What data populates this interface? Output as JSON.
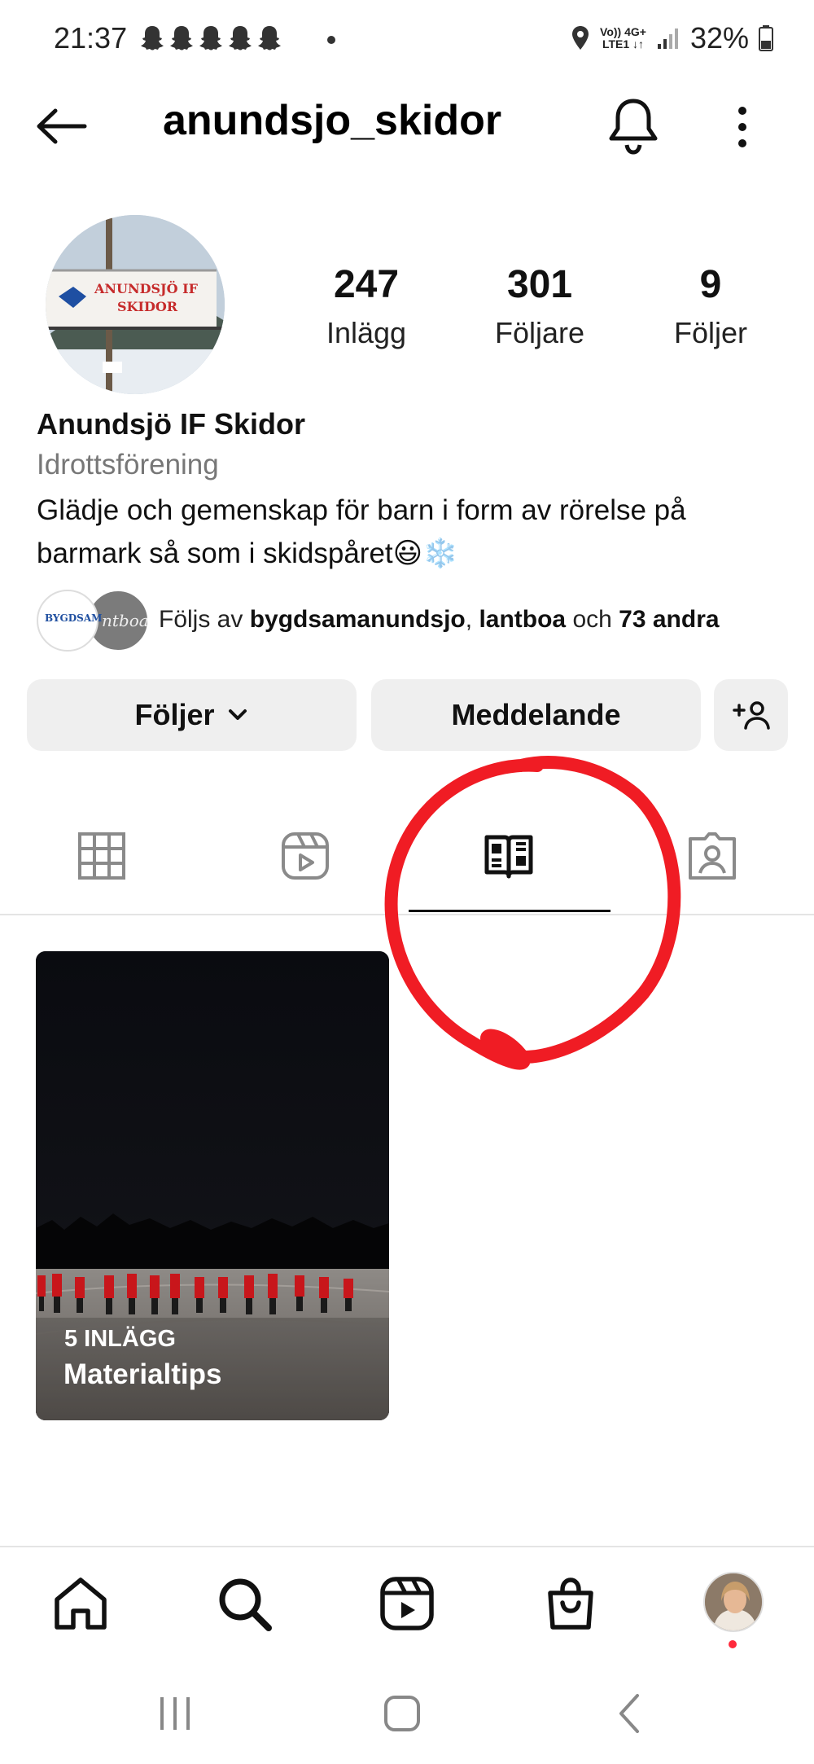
{
  "status_bar": {
    "time": "21:37",
    "network_top": "Vo)) 4G+",
    "network_bottom": "LTE1 ↓↑",
    "battery": "32%"
  },
  "header": {
    "username": "anundsjo_skidor"
  },
  "profile": {
    "avatar_sign_line1": "ANUNDSJÖ IF",
    "avatar_sign_line2": "SKIDOR",
    "stats": [
      {
        "value": "247",
        "label": "Inlägg"
      },
      {
        "value": "301",
        "label": "Följare"
      },
      {
        "value": "9",
        "label": "Följer"
      }
    ],
    "name": "Anundsjö IF Skidor",
    "category": "Idrottsförening",
    "bio": "Glädje och gemenskap för barn i form av rörelse på barmark så som i skidspåret😃❄️"
  },
  "followed_by": {
    "prefix": "Följs av",
    "user1": "bygdsamanundsjo",
    "separator": ",",
    "user2": "lantboa",
    "joiner": "och",
    "others": "73 andra",
    "fav1_text": "BYGDSAM",
    "fav2_text": "ntboa"
  },
  "actions": {
    "follow_label": "Följer",
    "message_label": "Meddelande"
  },
  "guide": {
    "count": "5 INLÄGG",
    "title": "Materialtips"
  },
  "colors": {
    "annotation_red": "#f01c24",
    "button_bg": "#efefef",
    "notification_dot": "#ff2a3c"
  }
}
